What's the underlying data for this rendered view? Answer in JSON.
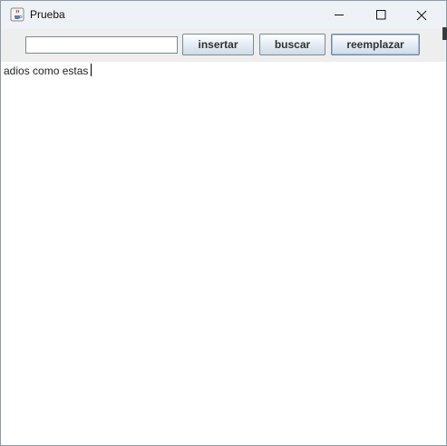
{
  "window": {
    "title": "Prueba",
    "app_icon": "java-cup-icon",
    "controls": [
      "minimize-icon",
      "maximize-icon",
      "close-icon"
    ]
  },
  "toolbar": {
    "input_value": "",
    "insert_label": "insertar",
    "search_label": "buscar",
    "replace_label": "reemplazar"
  },
  "editor": {
    "text": "adios como estas"
  }
}
